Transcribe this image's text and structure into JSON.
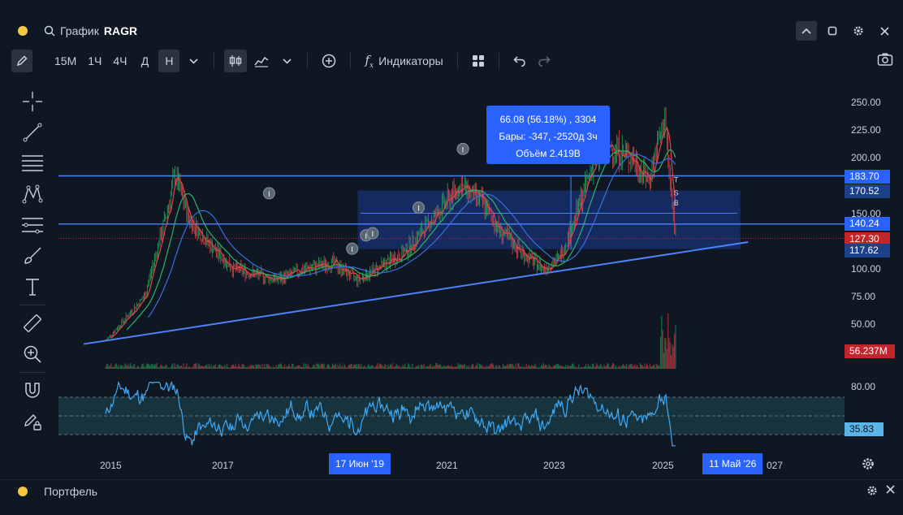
{
  "window": {
    "title_prefix": "График",
    "symbol": "RAGR"
  },
  "toolbar": {
    "timeframes": [
      {
        "label": "15М",
        "active": false
      },
      {
        "label": "1Ч",
        "active": false
      },
      {
        "label": "4Ч",
        "active": false
      },
      {
        "label": "Д",
        "active": false
      },
      {
        "label": "Н",
        "active": true
      }
    ],
    "indicators_label": "Индикаторы"
  },
  "price_axis": {
    "ticks": [
      "250.00",
      "225.00",
      "200.00",
      "150.00",
      "100.00",
      "75.00",
      "50.00"
    ],
    "labels": {
      "level_high": "183.70",
      "level_range_top": "170.52",
      "level_mid": "140.24",
      "last_price": "127.30",
      "level_range_bottom": "117.62",
      "volume": "56.237M"
    },
    "osc_ticks": [
      "80.00"
    ],
    "osc_value": "35.83"
  },
  "time_axis": {
    "ticks": [
      "2015",
      "2017",
      "2021",
      "2023",
      "2025",
      "027"
    ],
    "range_start": "17 Июн '19",
    "range_end": "11 Май '26"
  },
  "measure_tooltip": {
    "line1": "66.08 (56.18%) , 3304",
    "line2": "Бары: -347, -2520д 3ч",
    "line3": "Объём 2.419B"
  },
  "markers": {
    "t": "T",
    "s": "S",
    "b": "B",
    "i": "I"
  },
  "bottom_panel": {
    "title": "Портфель"
  },
  "colors": {
    "background": "#0f1722",
    "accent": "#2962ff",
    "levels": "#4d82ff",
    "volume_label": "#c0272d",
    "candle_up": "#26a65b",
    "candle_down": "#e0454a",
    "osc_line": "#3fa9f5"
  },
  "chart_data": {
    "type": "line",
    "x": [
      2014.9,
      2015.2,
      2015.6,
      2016.0,
      2016.15,
      2016.4,
      2016.8,
      2017.2,
      2017.6,
      2018.0,
      2018.5,
      2019.0,
      2019.45,
      2019.8,
      2020.3,
      2020.8,
      2021.3,
      2021.7,
      2022.0,
      2022.4,
      2022.8,
      2023.1,
      2023.4,
      2023.7,
      2024.0,
      2024.4,
      2024.7,
      2025.0,
      2025.1,
      2025.2
    ],
    "series": [
      {
        "values": [
          35,
          52,
          75,
          150,
          185,
          145,
          120,
          100,
          95,
          90,
          100,
          105,
          90,
          100,
          115,
          145,
          175,
          160,
          135,
          115,
          100,
          110,
          150,
          195,
          210,
          200,
          180,
          235,
          170,
          127
        ]
      }
    ],
    "ylim": [
      25,
      260
    ],
    "xlim": [
      2014.5,
      2027.2
    ]
  }
}
